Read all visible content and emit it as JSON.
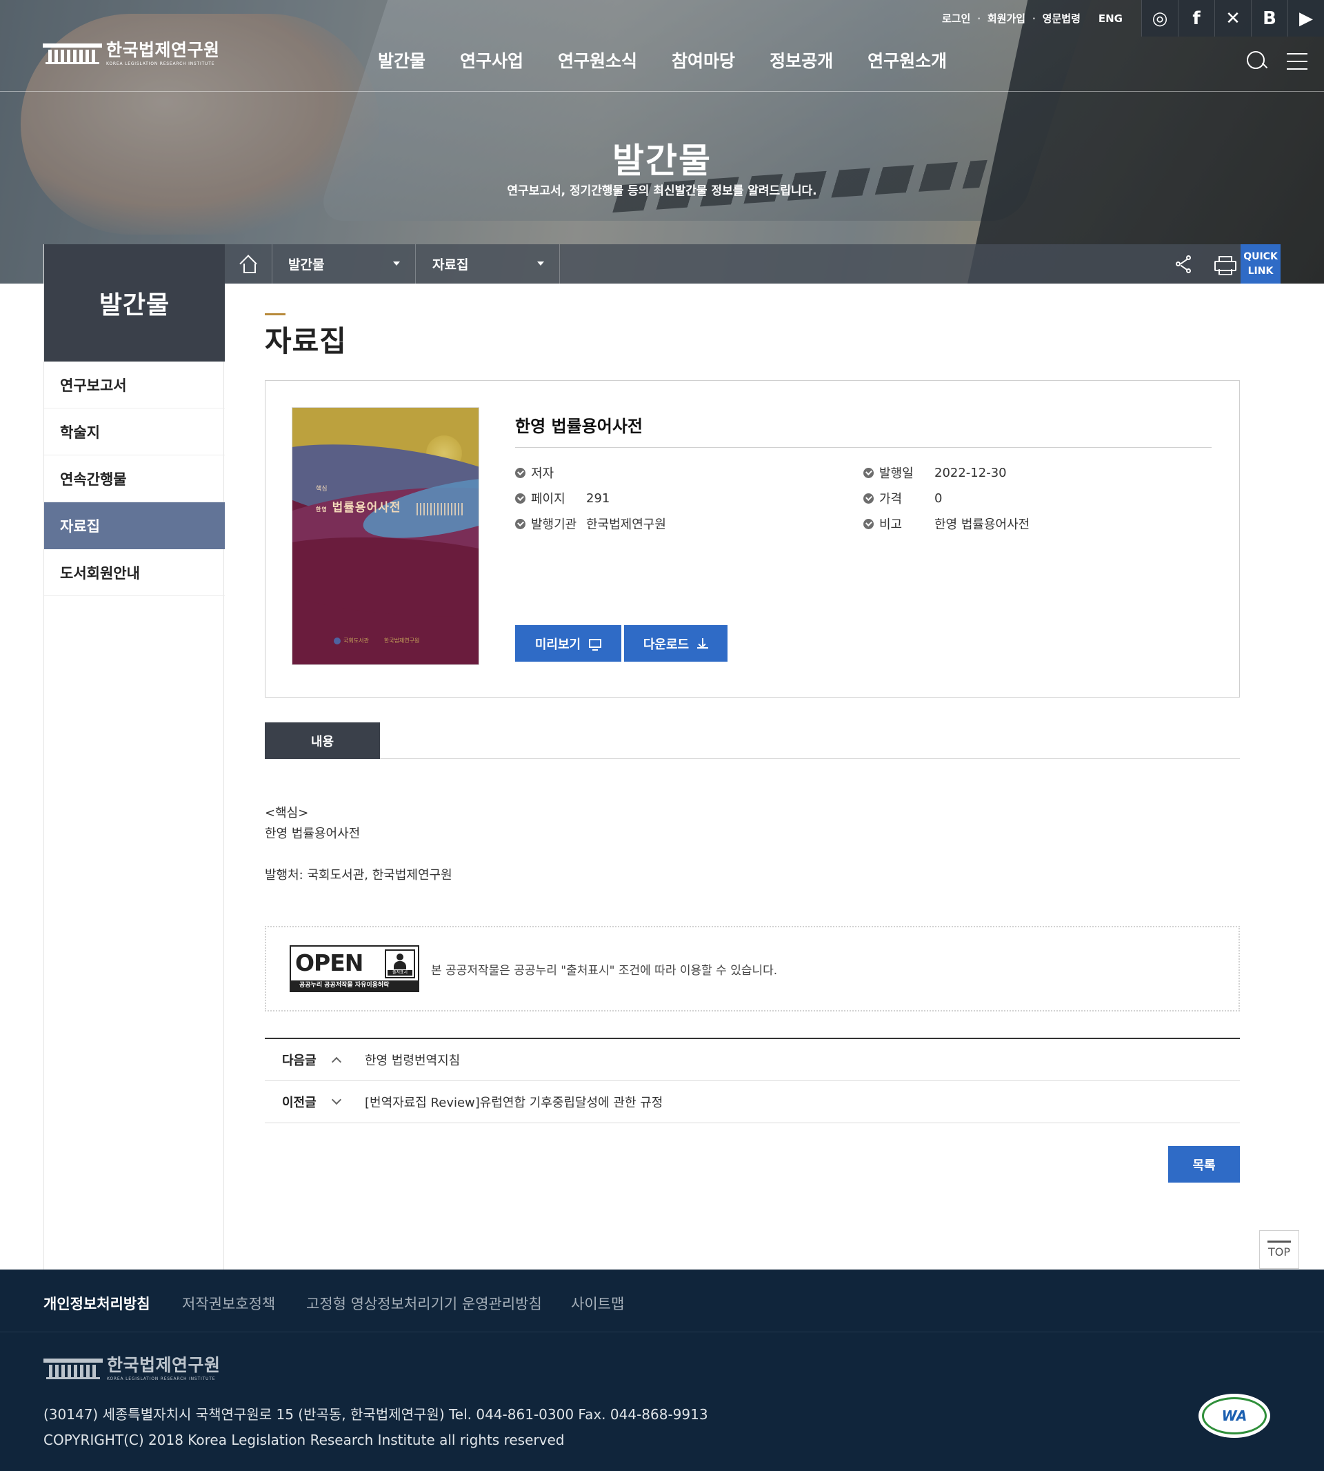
{
  "header": {
    "logo": {
      "ko": "한국법제연구원",
      "en": "KOREA LEGISLATION RESEARCH INSTITUTE"
    },
    "util_links": [
      "로그인",
      "회원가입",
      "영문법령"
    ],
    "eng_link": "ENG",
    "social": [
      {
        "name": "instagram-icon",
        "glyph": "◎"
      },
      {
        "name": "facebook-icon",
        "glyph": "f"
      },
      {
        "name": "x-icon",
        "glyph": "✕"
      },
      {
        "name": "blog-icon",
        "glyph": "B"
      },
      {
        "name": "youtube-icon",
        "glyph": "▶"
      }
    ],
    "gnb": [
      "발간물",
      "연구사업",
      "연구원소식",
      "참여마당",
      "정보공개",
      "연구원소개"
    ]
  },
  "hero": {
    "title": "발간물",
    "subtitle": "연구보고서, 정기간행물 등의 최신발간물 정보를 알려드립니다."
  },
  "lnb": {
    "title": "발간물",
    "items": [
      {
        "label": "연구보고서",
        "active": false
      },
      {
        "label": "학술지",
        "active": false
      },
      {
        "label": "연속간행물",
        "active": false
      },
      {
        "label": "자료집",
        "active": true
      },
      {
        "label": "도서회원안내",
        "active": false
      }
    ]
  },
  "location": {
    "depth1": "발간물",
    "depth2": "자료집",
    "quick_link": [
      "QUICK",
      "LINK"
    ]
  },
  "page": {
    "title": "자료집"
  },
  "book": {
    "title": "한영 법률용어사전",
    "cover": {
      "label": "핵심",
      "side": "한영",
      "title": "법률용어사전",
      "publishers": [
        "국회도서관",
        "한국법제연구원"
      ]
    },
    "meta_left": [
      {
        "key": "저자",
        "value": ""
      },
      {
        "key": "페이지",
        "value": "291"
      },
      {
        "key": "발행기관",
        "value": "한국법제연구원"
      }
    ],
    "meta_right": [
      {
        "key": "발행일",
        "value": "2022-12-30"
      },
      {
        "key": "가격",
        "value": "0"
      },
      {
        "key": "비고",
        "value": "한영 법률용어사전"
      }
    ],
    "preview_label": "미리보기",
    "download_label": "다운로드"
  },
  "tabs": [
    "내용"
  ],
  "description": [
    "<핵심>",
    "한영 법률용어사전",
    "",
    "발행처: 국회도서관, 한국법제연구원"
  ],
  "ogl": {
    "badge_open": "OPEN",
    "badge_type": "출처표시",
    "badge_bar": "공공누리  공공저작물 자유이용허락",
    "text": "본 공공저작물은 공공누리 \"출처표시\" 조건에 따라 이용할 수 있습니다."
  },
  "post_nav": {
    "next_label": "다음글",
    "next_title": "한영 법령번역지침",
    "prev_label": "이전글",
    "prev_title": "[번역자료집 Review]유럽연합 기후중립달성에 관한 규정"
  },
  "list_button": "목록",
  "top_button": "TOP",
  "footer": {
    "links": [
      {
        "label": "개인정보처리방침",
        "strong": true
      },
      {
        "label": "저작권보호정책",
        "strong": false
      },
      {
        "label": "고정형 영상정보처리기기 운영관리방침",
        "strong": false
      },
      {
        "label": "사이트맵",
        "strong": false
      }
    ],
    "logo_ko": "한국법제연구원",
    "logo_en": "KOREA LEGISLATION RESEARCH INSTITUTE",
    "address": "(30147) 세종특별자치시 국책연구원로 15 (반곡동, 한국법제연구원) Tel. 044-861-0300 Fax. 044-868-9913",
    "copyright": "COPYRIGHT(C) 2018 Korea Legislation Research Institute all rights reserved",
    "wa_mark": "WA"
  },
  "colors": {
    "accent_blue": "#2f6bc6",
    "nav_dark": "#3a404a",
    "lnb_active": "#627497",
    "footer_bg": "#10253b",
    "title_accent": "#b88a3b"
  }
}
